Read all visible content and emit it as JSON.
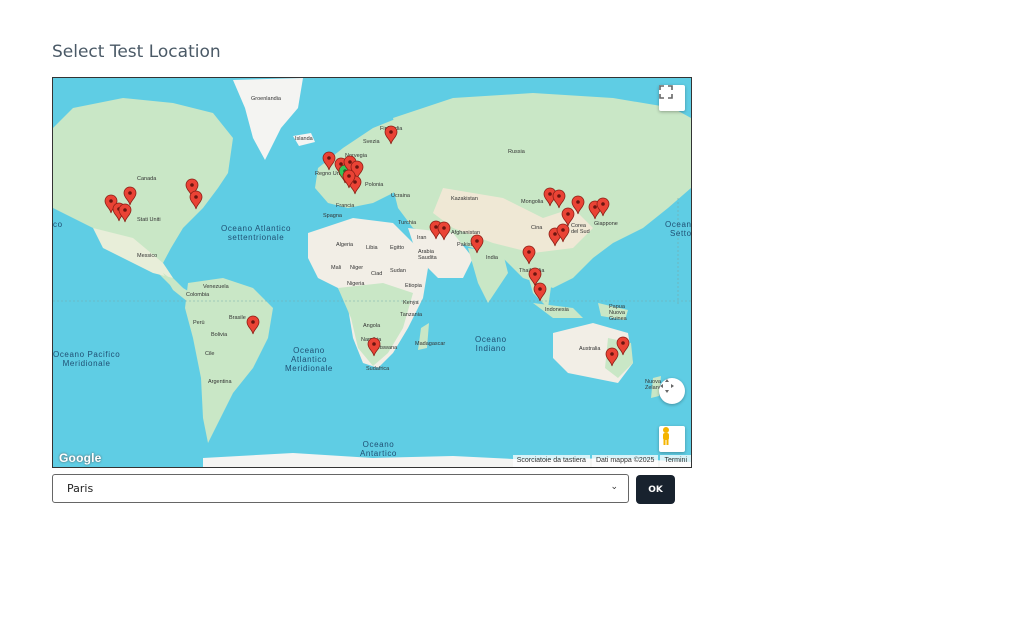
{
  "page": {
    "title": "Select Test Location"
  },
  "map": {
    "ocean_labels": {
      "atlantic_north": "Oceano Atlantico\nsettentrionale",
      "pacific_south": "Oceano Pacifico\nMeridionale",
      "atlantic_south": "Oceano\nAtlantico\nMeridionale",
      "indian": "Oceano\nIndiano",
      "antarctic": "Oceano\nAntartico",
      "east_left": "co",
      "east_right": "Oceano\nSetto"
    },
    "land_labels": {
      "greenland": "Groenlandia",
      "islanda": "Islanda",
      "canada": "Canada",
      "stati_uniti": "Stati Uniti",
      "messico": "Messico",
      "venezuela": "Venezuela",
      "colombia": "Colombia",
      "peru": "Perù",
      "brasile": "Brasile",
      "bolivia": "Bolivia",
      "cile": "Cile",
      "argentina": "Argentina",
      "norvegia": "Norvegia",
      "svezia": "Svezia",
      "finlandia": "Finlandia",
      "regno_unito": "Regno Unito",
      "polonia": "Polonia",
      "ucraina": "Ucraina",
      "francia": "Francia",
      "spagna": "Spagna",
      "russia": "Russia",
      "kazakistan": "Kazakistan",
      "turchia": "Turchia",
      "iran": "Iran",
      "afghanistan": "Afghanistan",
      "pakistan": "Pakistan",
      "india": "India",
      "arabia": "Arabia\nSaudita",
      "egitto": "Egitto",
      "libia": "Libia",
      "algeria": "Algeria",
      "mali": "Mali",
      "niger": "Niger",
      "ciad": "Ciad",
      "sudan": "Sudan",
      "nigeria": "Nigeria",
      "etiopia": "Etiopia",
      "kenya": "Kenya",
      "tanzania": "Tanzania",
      "angola": "Angola",
      "namibia": "Namibia",
      "botswana": "Botswana",
      "sudafrica": "Sudafrica",
      "madagascar": "Madagascar",
      "mongolia": "Mongolia",
      "cina": "Cina",
      "corea": "Corea\ndel Sud",
      "giappone": "Giappone",
      "thailandia": "Thailandia",
      "indonesia": "Indonesia",
      "papua": "Papua\nNuova\nGuinea",
      "australia": "Australia",
      "nuova_zelanda": "Nuova\nZelanda"
    },
    "google_logo": "Google",
    "attribution": {
      "shortcuts": "Scorciatoie da tastiera",
      "data": "Dati mappa ©2025",
      "terms": "Termini"
    },
    "icons": {
      "fullscreen": "fullscreen-icon",
      "camera": "camera-control-icon",
      "pegman": "pegman-icon",
      "pin": "map-pin-icon"
    },
    "colors": {
      "pin_default": "#ea4335",
      "pin_selected": "#34c759",
      "ocean": "#5fcde4",
      "land": "#c9e7c6",
      "land_dry": "#f2eee6"
    },
    "markers": [
      {
        "name": "seattle",
        "selected": false
      },
      {
        "name": "san-francisco",
        "selected": false
      },
      {
        "name": "los-angeles",
        "selected": false
      },
      {
        "name": "denver",
        "selected": false
      },
      {
        "name": "toronto",
        "selected": false
      },
      {
        "name": "new-york",
        "selected": false
      },
      {
        "name": "sao-paulo",
        "selected": false
      },
      {
        "name": "dublin",
        "selected": false
      },
      {
        "name": "london",
        "selected": false
      },
      {
        "name": "paris",
        "selected": true
      },
      {
        "name": "amsterdam",
        "selected": false
      },
      {
        "name": "frankfurt",
        "selected": false
      },
      {
        "name": "stockholm",
        "selected": false
      },
      {
        "name": "milan",
        "selected": false
      },
      {
        "name": "zurich",
        "selected": false
      },
      {
        "name": "dubai",
        "selected": false
      },
      {
        "name": "bahrain",
        "selected": false
      },
      {
        "name": "mumbai",
        "selected": false
      },
      {
        "name": "singapore",
        "selected": false
      },
      {
        "name": "jakarta",
        "selected": false
      },
      {
        "name": "bangkok",
        "selected": false
      },
      {
        "name": "hong-kong",
        "selected": false
      },
      {
        "name": "guangzhou",
        "selected": false
      },
      {
        "name": "beijing",
        "selected": false
      },
      {
        "name": "tianjin",
        "selected": false
      },
      {
        "name": "shanghai",
        "selected": false
      },
      {
        "name": "seoul",
        "selected": false
      },
      {
        "name": "osaka",
        "selected": false
      },
      {
        "name": "tokyo",
        "selected": false
      },
      {
        "name": "cape-town",
        "selected": false
      },
      {
        "name": "melbourne",
        "selected": false
      },
      {
        "name": "sydney",
        "selected": false
      }
    ]
  },
  "location_select": {
    "value": "Paris"
  },
  "ok_button": {
    "label": "OK"
  }
}
